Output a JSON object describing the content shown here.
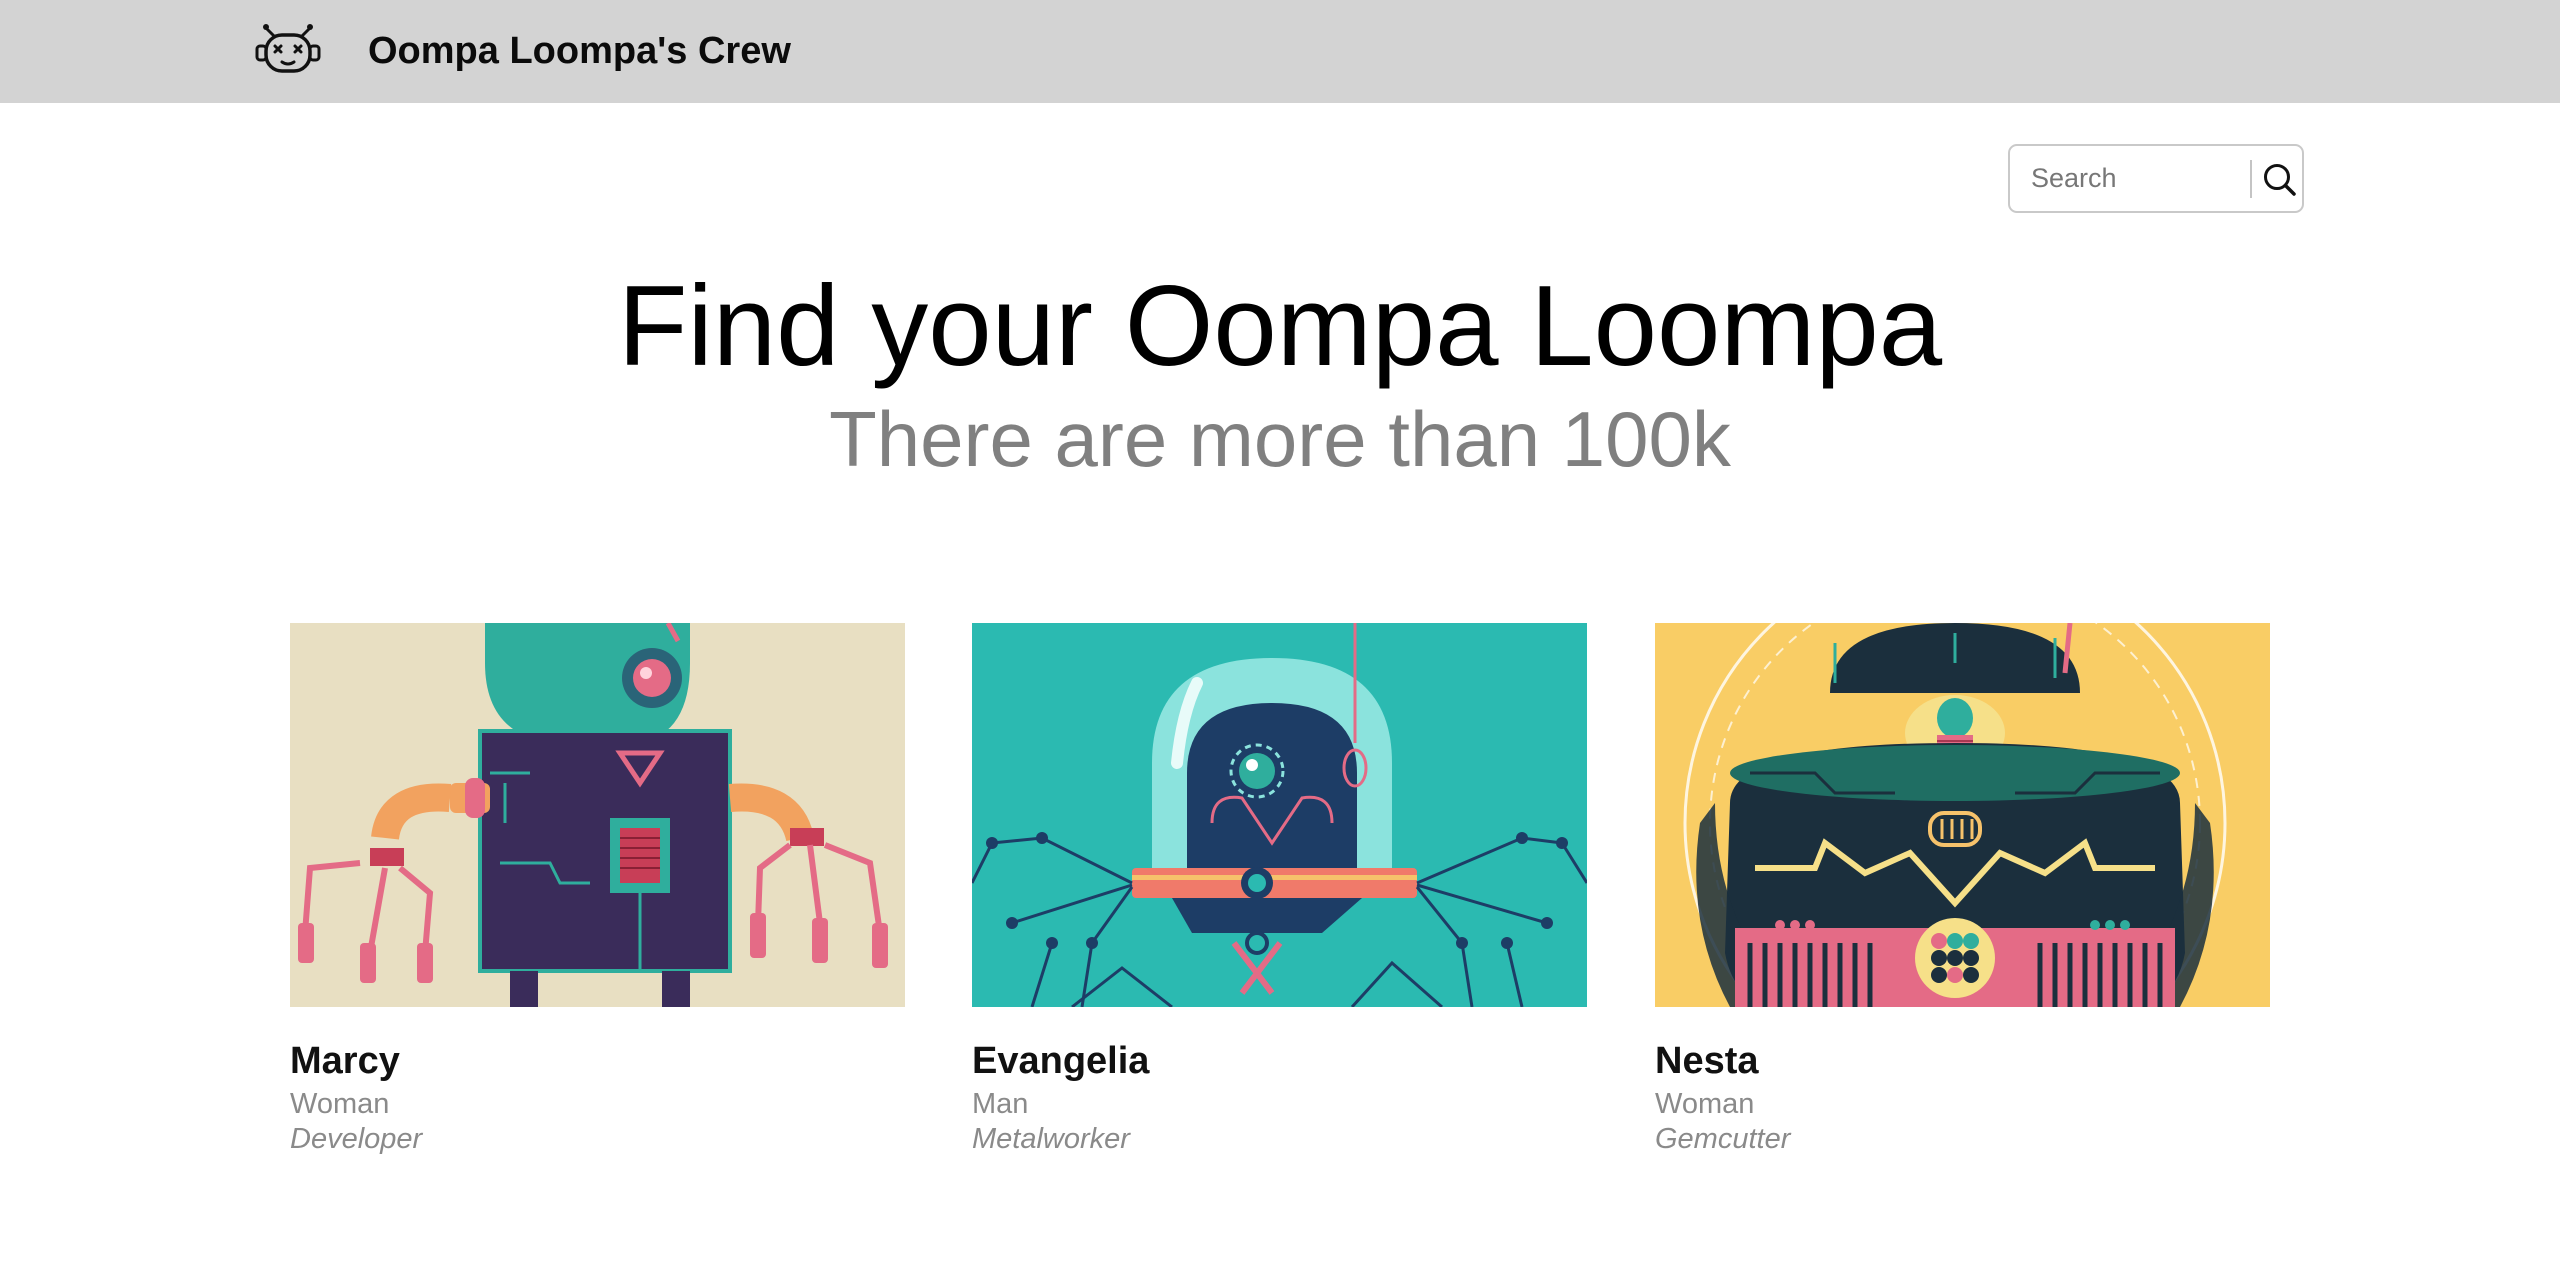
{
  "header": {
    "logo_icon": "robot-face-icon",
    "brand": "Oompa Loompa's Crew",
    "background": "#d3d3d3"
  },
  "search": {
    "placeholder": "Search",
    "value": "",
    "icon": "search-icon"
  },
  "hero": {
    "title": "Find your Oompa Loompa",
    "subtitle": "There are more than 100k"
  },
  "cards": [
    {
      "name": "Marcy",
      "gender": "Woman",
      "profession": "Developer",
      "image_background": "#e8dfc2"
    },
    {
      "name": "Evangelia",
      "gender": "Man",
      "profession": "Metalworker",
      "image_background": "#2bbab1"
    },
    {
      "name": "Nesta",
      "gender": "Woman",
      "profession": "Gemcutter",
      "image_background": "#f9cd65"
    }
  ]
}
